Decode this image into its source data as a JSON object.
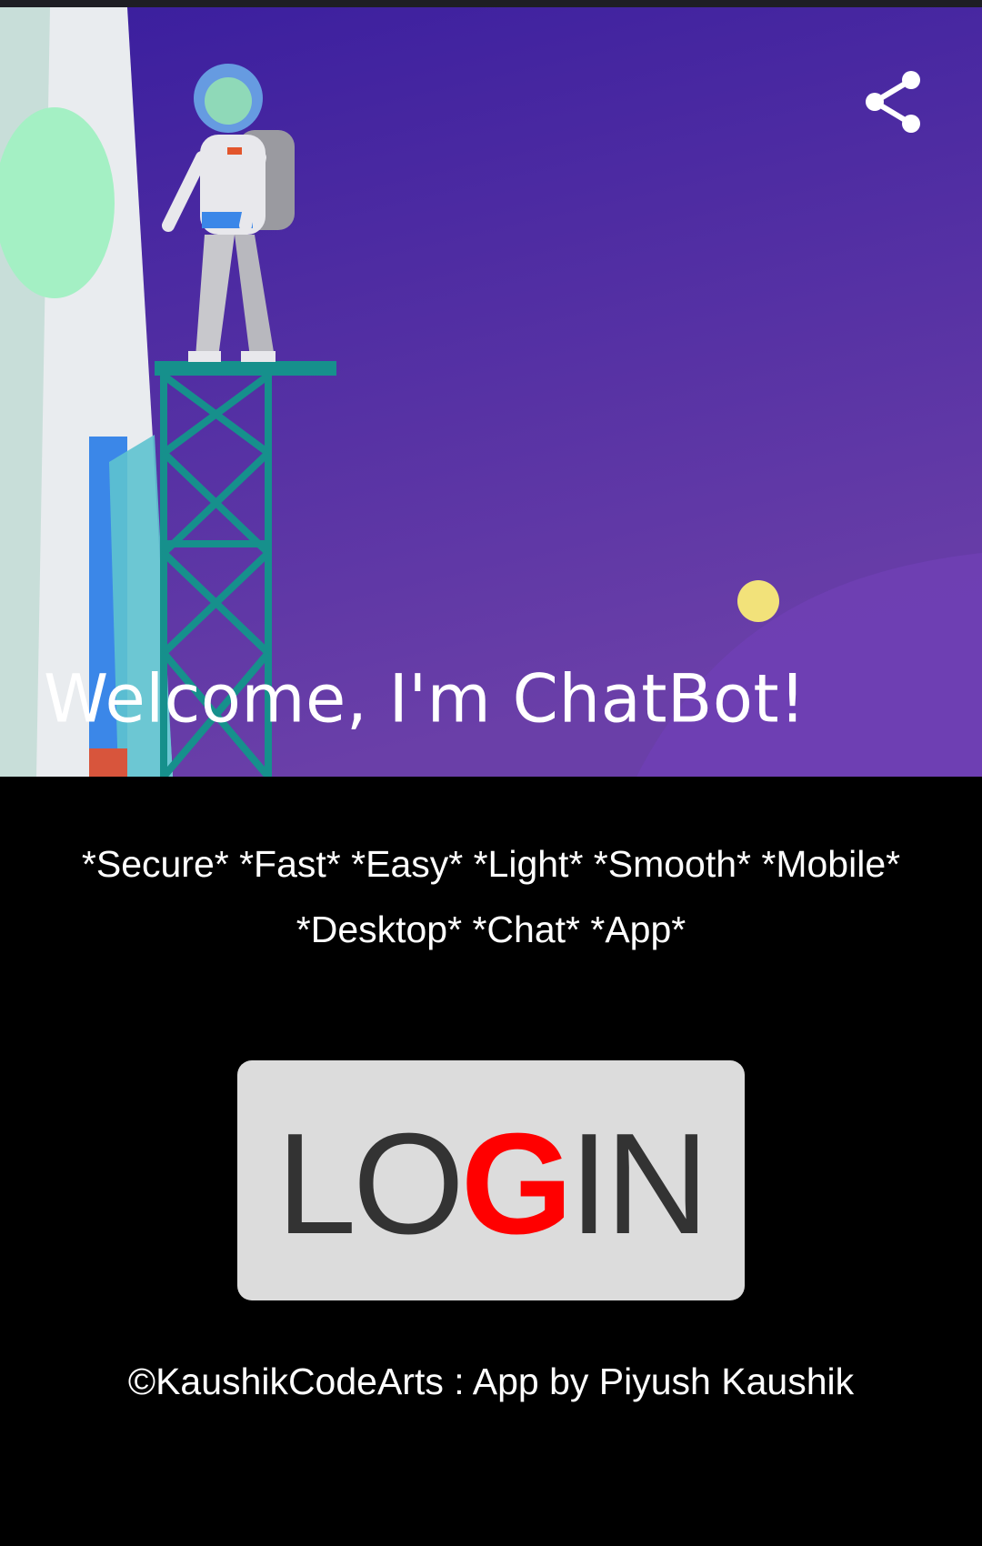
{
  "hero": {
    "title": "Welcome, I'm ChatBot!",
    "share_icon": "share-icon",
    "colors": {
      "sky_top": "#3a1e9e",
      "sky_bottom": "#6a3fa8",
      "moon": "#f2e27a"
    }
  },
  "tagline": {
    "line1": "*Secure* *Fast* *Easy* *Light* *Smooth* *Mobile*",
    "line2": "*Desktop* *Chat* *App*"
  },
  "login_button": {
    "part1": "LO",
    "part2": "G",
    "part3": "IN",
    "accent_color": "#ff0000",
    "background": "#dcdcdc"
  },
  "footer": {
    "text": "©KaushikCodeArts : App by Piyush Kaushik"
  }
}
